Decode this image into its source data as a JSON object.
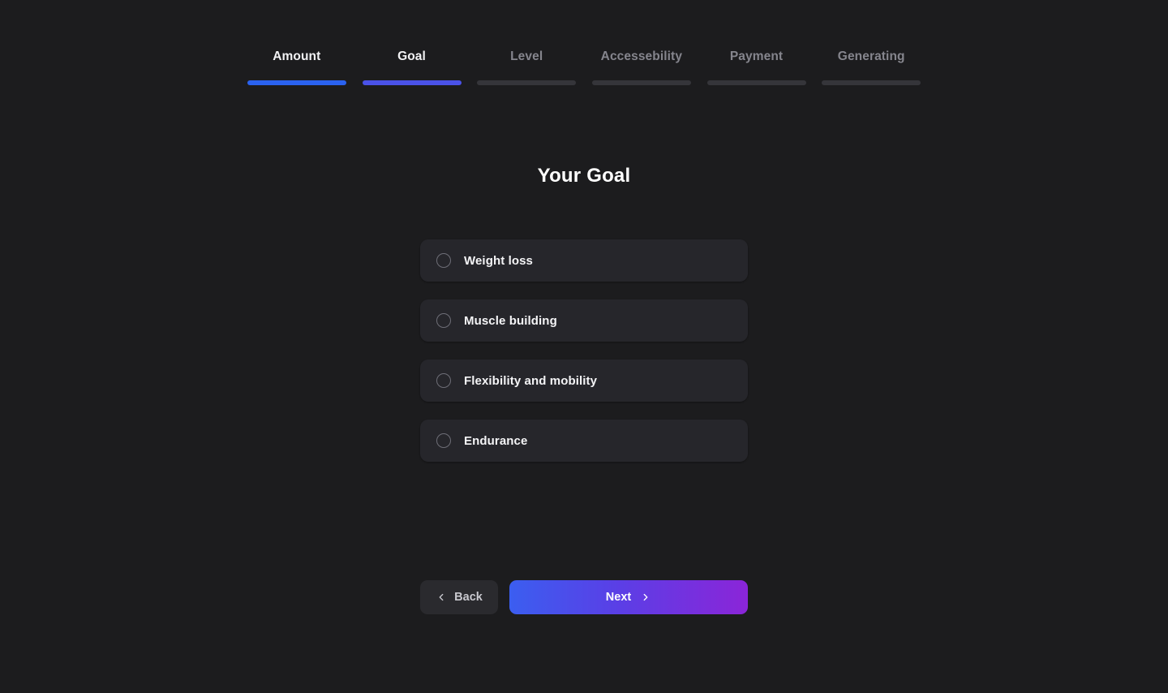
{
  "page": {
    "title": "Your Goal",
    "background_color": "#1c1c1e"
  },
  "stepper": {
    "steps": [
      {
        "label": "Amount",
        "state": "active",
        "bar_color": "#2a62f0"
      },
      {
        "label": "Goal",
        "state": "active",
        "bar_color": "#4a52e8"
      },
      {
        "label": "Level",
        "state": "inactive",
        "bar_color": "#35353a"
      },
      {
        "label": "Accessebility",
        "state": "inactive",
        "bar_color": "#35353a"
      },
      {
        "label": "Payment",
        "state": "inactive",
        "bar_color": "#35353a"
      },
      {
        "label": "Generating",
        "state": "inactive",
        "bar_color": "#35353a"
      }
    ]
  },
  "options": {
    "selected": null,
    "items": [
      {
        "label": "Weight loss",
        "selected": false
      },
      {
        "label": "Muscle building",
        "selected": false
      },
      {
        "label": "Flexibility and mobility",
        "selected": false
      },
      {
        "label": "Endurance",
        "selected": false
      }
    ]
  },
  "footer": {
    "back_label": "Back",
    "next_label": "Next",
    "back_icon": "chevron-left-icon",
    "next_icon": "chevron-right-icon",
    "next_gradient_start": "#3b5ef0",
    "next_gradient_end": "#8b25d8"
  }
}
